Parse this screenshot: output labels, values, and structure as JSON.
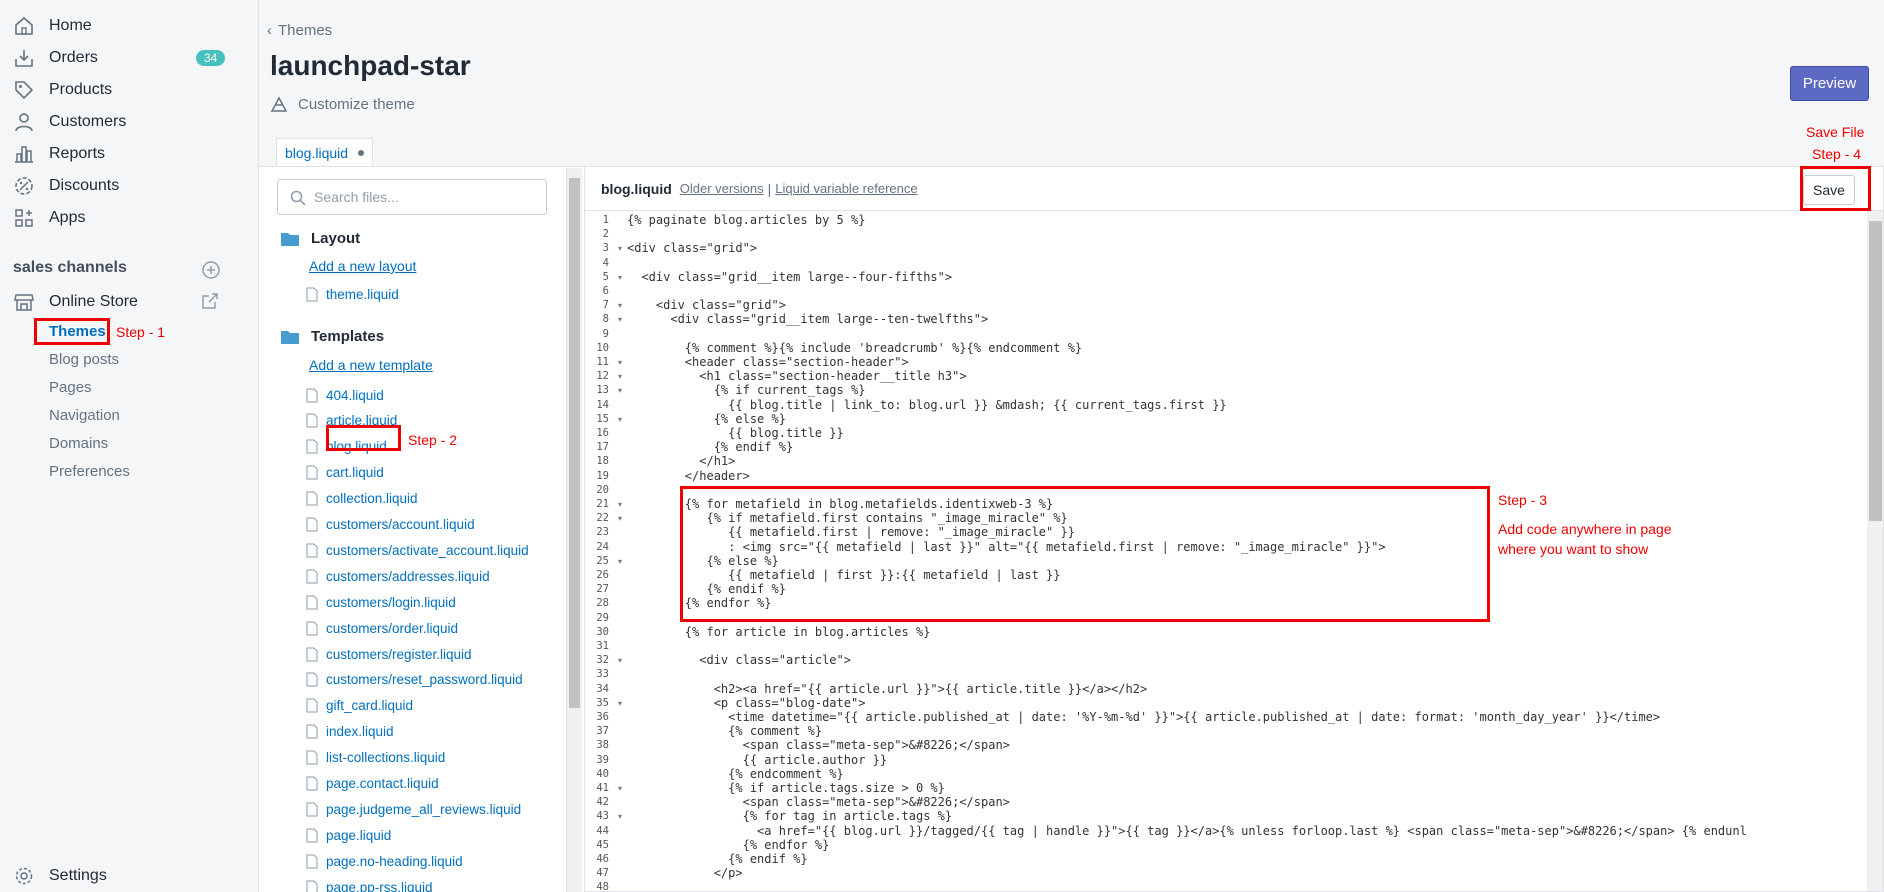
{
  "sidebar": {
    "items": [
      {
        "label": "Home",
        "icon": "home-icon"
      },
      {
        "label": "Orders",
        "icon": "orders-icon",
        "badge": "34"
      },
      {
        "label": "Products",
        "icon": "tag-icon"
      },
      {
        "label": "Customers",
        "icon": "person-icon"
      },
      {
        "label": "Reports",
        "icon": "bar-chart-icon"
      },
      {
        "label": "Discounts",
        "icon": "discount-icon"
      },
      {
        "label": "Apps",
        "icon": "apps-icon"
      }
    ],
    "sales_channels_title": "sales channels",
    "online_store": "Online Store",
    "sub_items": [
      "Themes",
      "Blog posts",
      "Pages",
      "Navigation",
      "Domains",
      "Preferences"
    ],
    "settings": "Settings"
  },
  "header": {
    "breadcrumb": "Themes",
    "title": "launchpad-star",
    "customize": "Customize theme",
    "preview": "Preview"
  },
  "tab": {
    "label": "blog.liquid"
  },
  "files": {
    "search_placeholder": "Search files...",
    "layout_title": "Layout",
    "add_layout": "Add a new layout",
    "layout_files": [
      "theme.liquid"
    ],
    "templates_title": "Templates",
    "add_template": "Add a new template",
    "template_files": [
      "404.liquid",
      "article.liquid",
      "blog.liquid",
      "cart.liquid",
      "collection.liquid",
      "customers/account.liquid",
      "customers/activate_account.liquid",
      "customers/addresses.liquid",
      "customers/login.liquid",
      "customers/order.liquid",
      "customers/register.liquid",
      "customers/reset_password.liquid",
      "gift_card.liquid",
      "index.liquid",
      "list-collections.liquid",
      "page.contact.liquid",
      "page.judgeme_all_reviews.liquid",
      "page.liquid",
      "page.no-heading.liquid",
      "page.pp-rss.liquid"
    ]
  },
  "editor": {
    "filename": "blog.liquid",
    "older_versions": "Older versions",
    "separator": "|",
    "liquid_ref": "Liquid variable reference",
    "save": "Save",
    "lines": [
      "{% paginate blog.articles by 5 %}",
      "",
      "<div class=\"grid\">",
      "",
      "  <div class=\"grid__item large--four-fifths\">",
      "",
      "    <div class=\"grid\">",
      "      <div class=\"grid__item large--ten-twelfths\">",
      "",
      "        {% comment %}{% include 'breadcrumb' %}{% endcomment %}",
      "        <header class=\"section-header\">",
      "          <h1 class=\"section-header__title h3\">",
      "            {% if current_tags %}",
      "              {{ blog.title | link_to: blog.url }} &mdash; {{ current_tags.first }}",
      "            {% else %}",
      "              {{ blog.title }}",
      "            {% endif %}",
      "          </h1>",
      "        </header>",
      "",
      "        {% for metafield in blog.metafields.identixweb-3 %}",
      "           {% if metafield.first contains \"_image_miracle\" %}",
      "              {{ metafield.first | remove: \"_image_miracle\" }}",
      "              : <img src=\"{{ metafield | last }}\" alt=\"{{ metafield.first | remove: \"_image_miracle\" }}\">",
      "           {% else %}",
      "              {{ metafield | first }}:{{ metafield | last }}",
      "           {% endif %}",
      "        {% endfor %}",
      "",
      "        {% for article in blog.articles %}",
      "",
      "          <div class=\"article\">",
      "",
      "            <h2><a href=\"{{ article.url }}\">{{ article.title }}</a></h2>",
      "            <p class=\"blog-date\">",
      "              <time datetime=\"{{ article.published_at | date: '%Y-%m-%d' }}\">{{ article.published_at | date: format: 'month_day_year' }}</time>",
      "              {% comment %}",
      "                <span class=\"meta-sep\">&#8226;</span>",
      "                {{ article.author }}",
      "              {% endcomment %}",
      "              {% if article.tags.size > 0 %}",
      "                <span class=\"meta-sep\">&#8226;</span>",
      "                {% for tag in article.tags %}",
      "                  <a href=\"{{ blog.url }}/tagged/{{ tag | handle }}\">{{ tag }}</a>{% unless forloop.last %} <span class=\"meta-sep\">&#8226;</span> {% endunl",
      "                {% endfor %}",
      "              {% endif %}",
      "            </p>",
      ""
    ]
  },
  "annotations": {
    "step1": "Step - 1",
    "step2": "Step - 2",
    "step3": "Step - 3",
    "step3_desc_1": "Add code anywhere in page",
    "step3_desc_2": "where you want to show",
    "step4_1": "Save File",
    "step4_2": "Step - 4"
  }
}
